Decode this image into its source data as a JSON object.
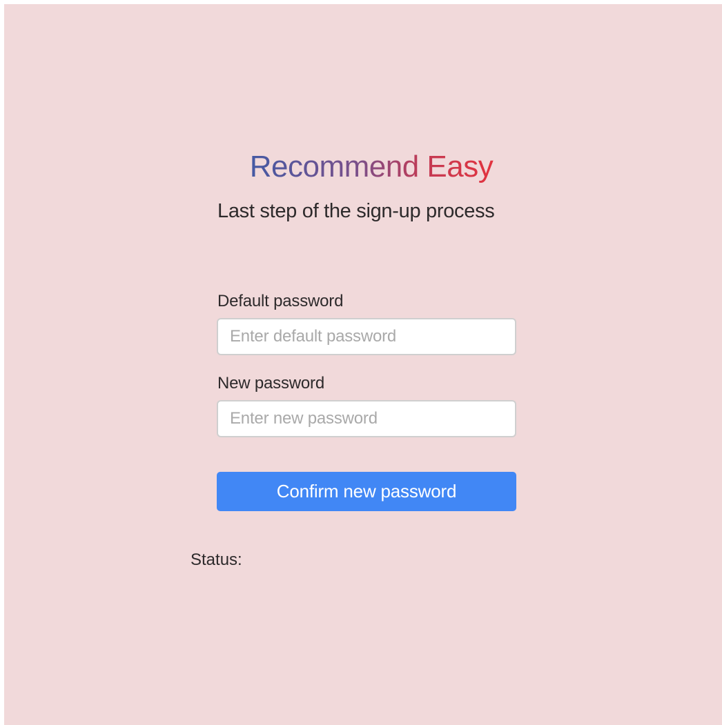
{
  "brand": {
    "title": "Recommend Easy"
  },
  "header": {
    "subtitle": "Last step of the sign-up process"
  },
  "form": {
    "default_password": {
      "label": "Default password",
      "placeholder": "Enter default password",
      "value": ""
    },
    "new_password": {
      "label": "New password",
      "placeholder": "Enter new password",
      "value": ""
    },
    "confirm_label": "Confirm new password"
  },
  "status": {
    "label": "Status:"
  },
  "colors": {
    "background": "#f1d9da",
    "button": "#4187f5",
    "title_gradient_start": "#3e5ba7",
    "title_gradient_end": "#e8323b"
  }
}
